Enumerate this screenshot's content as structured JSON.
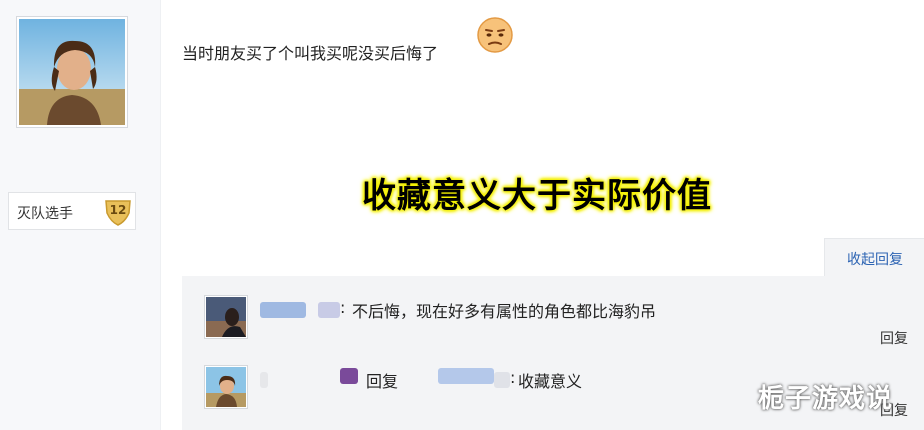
{
  "post": {
    "text": "当时朋友买了个叫我买呢没买后悔了",
    "emoji": "unamused-face-emoji",
    "caption": "收藏意义大于实际价值"
  },
  "author": {
    "level_name": "灭队选手",
    "level_number": "12"
  },
  "replies": {
    "collapse_label": "收起回复",
    "items": [
      {
        "text": "不后悔，现在好多有属性的角色都比海豹吊",
        "reply_label": "回复"
      },
      {
        "reply_word": "回复",
        "text": "收藏意义",
        "reply_label": "回复"
      }
    ]
  },
  "watermark": "栀子游戏说",
  "colors": {
    "link": "#2d64b3",
    "highlight": "#f4f000",
    "panel_bg": "#f3f4f6"
  }
}
